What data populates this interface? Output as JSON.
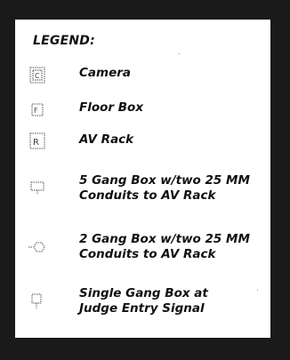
{
  "legend": {
    "title": "LEGEND:",
    "items": [
      {
        "icon": "camera-icon",
        "lines": [
          "Camera"
        ]
      },
      {
        "icon": "floor-box-icon",
        "lines": [
          "Floor Box"
        ]
      },
      {
        "icon": "av-rack-icon",
        "lines": [
          "AV Rack"
        ]
      },
      {
        "icon": "five-gang-box-icon",
        "lines": [
          "5 Gang Box w/two 25 MM",
          "Conduits to AV Rack"
        ]
      },
      {
        "icon": "two-gang-box-icon",
        "lines": [
          "2 Gang Box w/two 25 MM",
          "Conduits to AV Rack"
        ]
      },
      {
        "icon": "single-gang-box-icon",
        "lines": [
          "Single Gang Box at",
          "Judge Entry Signal"
        ]
      }
    ]
  }
}
